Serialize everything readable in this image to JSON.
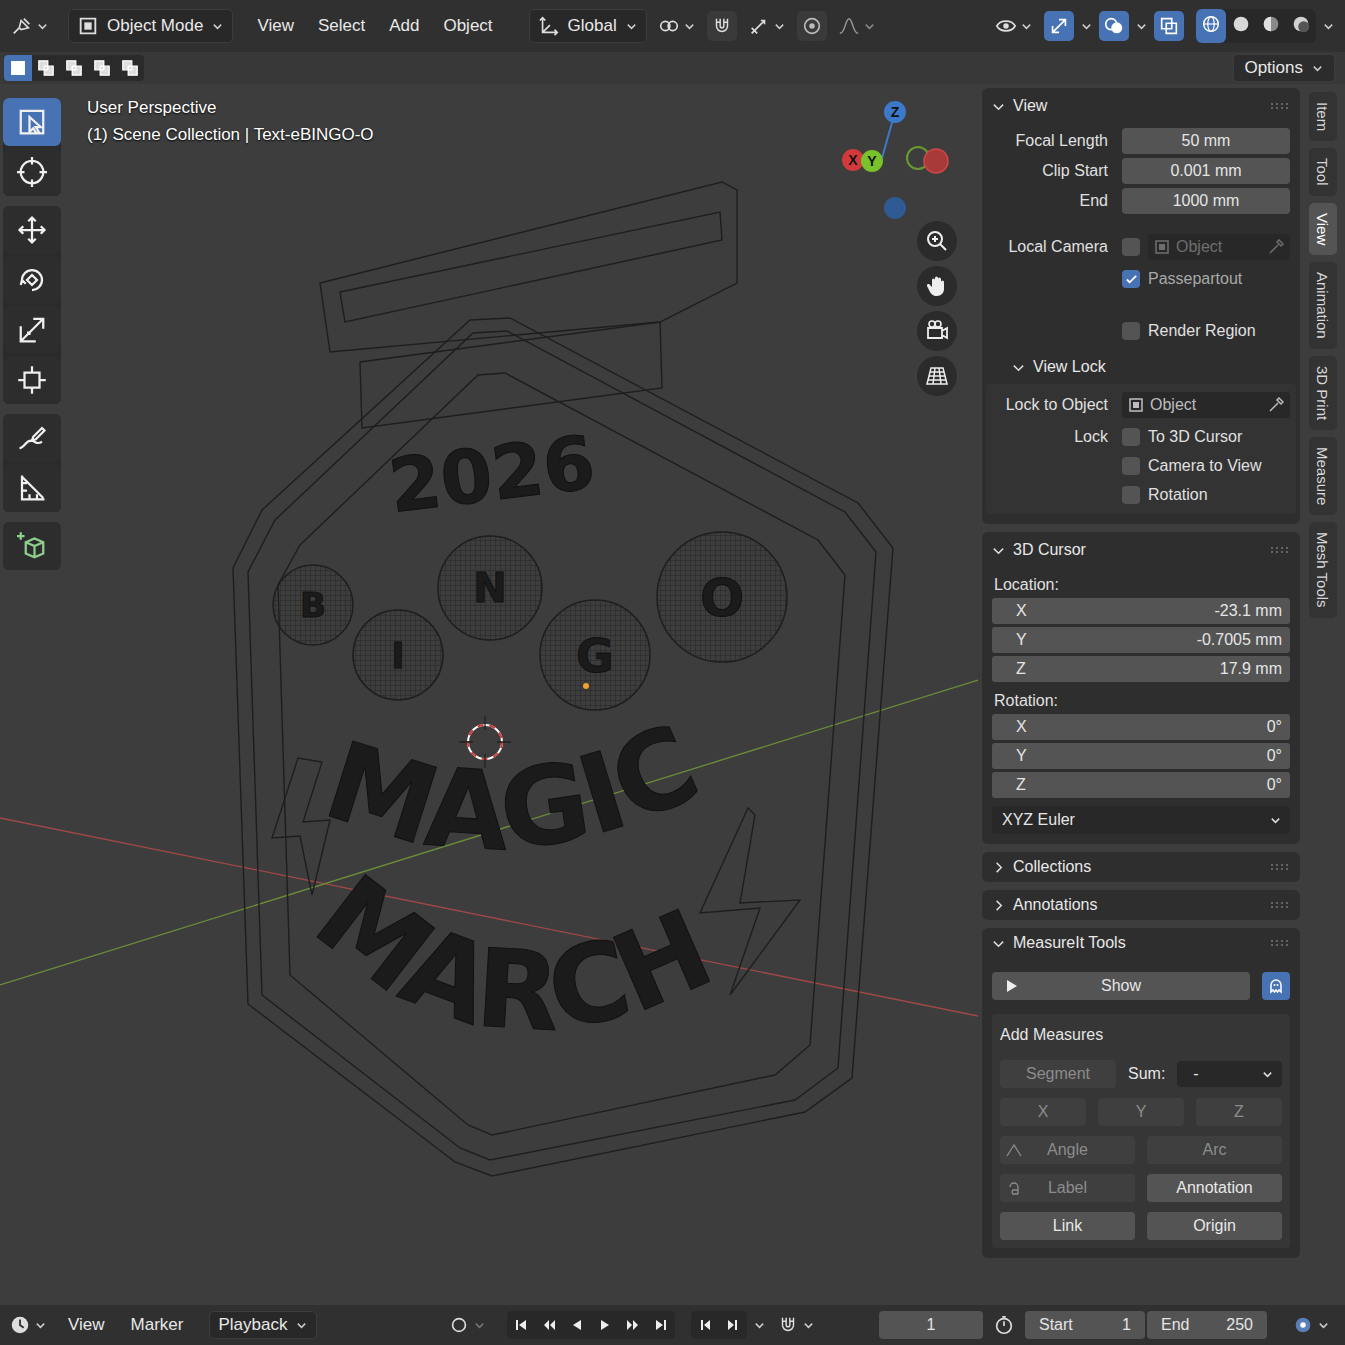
{
  "header": {
    "mode": "Object Mode",
    "menus": [
      "View",
      "Select",
      "Add",
      "Object"
    ],
    "orientation": "Global",
    "snap_on": false,
    "proportional_on": false,
    "gizmos_on": true,
    "overlays_on": true,
    "xray_on": true,
    "shading": [
      {
        "kind": "wireframe",
        "selected": true
      },
      {
        "kind": "solid",
        "selected": false
      },
      {
        "kind": "material",
        "selected": false
      },
      {
        "kind": "rendered",
        "selected": false
      }
    ]
  },
  "tool_settings": {
    "select_modes": [
      {
        "kind": "set",
        "selected": true
      },
      {
        "kind": "extend",
        "selected": false
      },
      {
        "kind": "subtract",
        "selected": false
      },
      {
        "kind": "invert",
        "selected": false
      },
      {
        "kind": "intersect",
        "selected": false
      }
    ],
    "options": "Options"
  },
  "toolbar": [
    [
      {
        "kind": "select",
        "selected": true
      },
      {
        "kind": "cursor",
        "selected": false
      }
    ],
    [
      {
        "kind": "move",
        "selected": false
      },
      {
        "kind": "rotate",
        "selected": false
      },
      {
        "kind": "scale",
        "selected": false
      },
      {
        "kind": "transform",
        "selected": false
      }
    ],
    [
      {
        "kind": "annotate",
        "selected": false
      },
      {
        "kind": "measure",
        "selected": false
      }
    ],
    [
      {
        "kind": "add_cube",
        "selected": false
      }
    ]
  ],
  "viewport": {
    "view_name": "User Perspective",
    "info": "(1) Scene Collection | Text-eBINGO-O",
    "gizmo": {
      "z": "Z",
      "x": "X",
      "y": "Y"
    },
    "model": {
      "year": "2026",
      "balls": [
        "B",
        "I",
        "N",
        "G",
        "O"
      ],
      "words": [
        "MAGIC",
        "MARCH"
      ]
    }
  },
  "sidebar": {
    "view": {
      "title": "View",
      "expanded": true,
      "fields": [
        {
          "label": "Focal Length",
          "value": "50 mm"
        },
        {
          "label": "Clip Start",
          "value": "0.001 mm"
        },
        {
          "label": "End",
          "value": "1000 mm"
        }
      ],
      "local_camera": {
        "label": "Local Camera",
        "checked": false,
        "placeholder": "Object",
        "disabled": true
      },
      "checks": [
        {
          "label": "Passepartout",
          "checked": true,
          "disabled": true
        },
        {
          "label": "Render Region",
          "checked": false,
          "disabled": false
        }
      ],
      "view_lock": {
        "title": "View Lock",
        "expanded": true,
        "object_label": "Lock to Object",
        "object_placeholder": "Object",
        "lock_label": "Lock",
        "options": [
          {
            "label": "To 3D Cursor",
            "checked": false
          },
          {
            "label": "Camera to View",
            "checked": false
          },
          {
            "label": "Rotation",
            "checked": false
          }
        ]
      }
    },
    "cursor": {
      "title": "3D Cursor",
      "expanded": true,
      "location_label": "Location:",
      "location": [
        {
          "axis": "X",
          "value": "-23.1 mm"
        },
        {
          "axis": "Y",
          "value": "-0.7005 mm"
        },
        {
          "axis": "Z",
          "value": "17.9 mm"
        }
      ],
      "rotation_label": "Rotation:",
      "rotation": [
        {
          "axis": "X",
          "value": "0°"
        },
        {
          "axis": "Y",
          "value": "0°"
        },
        {
          "axis": "Z",
          "value": "0°"
        }
      ],
      "rotation_mode": "XYZ Euler"
    },
    "collapsed": [
      {
        "title": "Collections",
        "expanded": false
      },
      {
        "title": "Annotations",
        "expanded": false
      }
    ],
    "measureit": {
      "title": "MeasureIt Tools",
      "expanded": true,
      "show": "Show",
      "add_title": "Add Measures",
      "segment": {
        "label": "Segment",
        "disabled": true
      },
      "sum_label": "Sum:",
      "sum_value": "-",
      "axes": [
        {
          "label": "X",
          "disabled": true
        },
        {
          "label": "Y",
          "disabled": true
        },
        {
          "label": "Z",
          "disabled": true
        }
      ],
      "pairs": [
        [
          {
            "label": "Angle",
            "disabled": true,
            "kind": "angle"
          },
          {
            "label": "Arc",
            "disabled": true,
            "kind": "plain"
          }
        ],
        [
          {
            "label": "Label",
            "disabled": true,
            "kind": "label"
          },
          {
            "label": "Annotation",
            "disabled": false,
            "kind": "plain"
          }
        ],
        [
          {
            "label": "Link",
            "disabled": false,
            "kind": "plain"
          },
          {
            "label": "Origin",
            "disabled": false,
            "kind": "plain"
          }
        ]
      ]
    }
  },
  "tabs": [
    {
      "label": "Item",
      "selected": false
    },
    {
      "label": "Tool",
      "selected": false
    },
    {
      "label": "View",
      "selected": true
    },
    {
      "label": "Animation",
      "selected": false
    },
    {
      "label": "3D Print",
      "selected": false
    },
    {
      "label": "Measure",
      "selected": false
    },
    {
      "label": "Mesh Tools",
      "selected": false
    }
  ],
  "timeline": {
    "menus": [
      "View",
      "Marker"
    ],
    "playback": "Playback",
    "current_frame": "1",
    "start_label": "Start",
    "start": "1",
    "end_label": "End",
    "end": "250"
  }
}
